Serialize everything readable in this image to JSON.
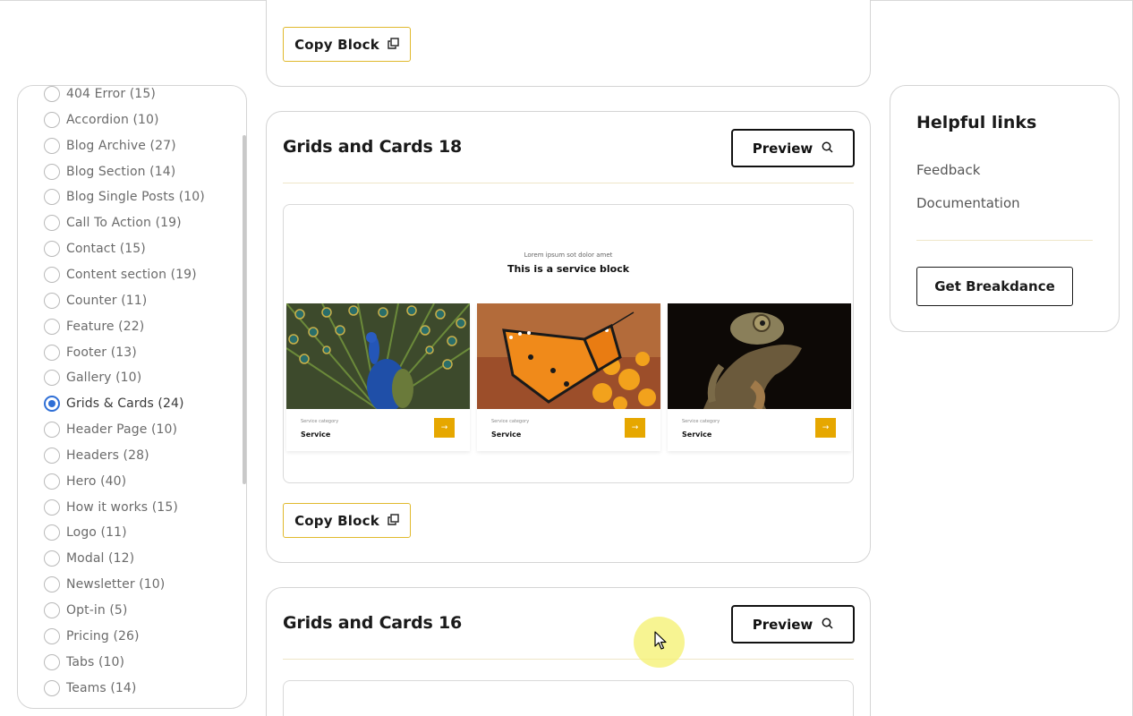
{
  "categories": [
    {
      "label": "404 Error (15)",
      "checked": false
    },
    {
      "label": "Accordion (10)",
      "checked": false
    },
    {
      "label": "Blog Archive (27)",
      "checked": false
    },
    {
      "label": "Blog Section (14)",
      "checked": false
    },
    {
      "label": "Blog Single Posts (10)",
      "checked": false
    },
    {
      "label": "Call To Action (19)",
      "checked": false
    },
    {
      "label": "Contact (15)",
      "checked": false
    },
    {
      "label": "Content section (19)",
      "checked": false
    },
    {
      "label": "Counter (11)",
      "checked": false
    },
    {
      "label": "Feature (22)",
      "checked": false
    },
    {
      "label": "Footer (13)",
      "checked": false
    },
    {
      "label": "Gallery (10)",
      "checked": false
    },
    {
      "label": "Grids & Cards (24)",
      "checked": true
    },
    {
      "label": "Header Page (10)",
      "checked": false
    },
    {
      "label": "Headers (28)",
      "checked": false
    },
    {
      "label": "Hero (40)",
      "checked": false
    },
    {
      "label": "How it works (15)",
      "checked": false
    },
    {
      "label": "Logo (11)",
      "checked": false
    },
    {
      "label": "Modal (12)",
      "checked": false
    },
    {
      "label": "Newsletter (10)",
      "checked": false
    },
    {
      "label": "Opt-in (5)",
      "checked": false
    },
    {
      "label": "Pricing (26)",
      "checked": false
    },
    {
      "label": "Tabs (10)",
      "checked": false
    },
    {
      "label": "Teams (14)",
      "checked": false
    }
  ],
  "blocks": {
    "top": {
      "copy_label": "Copy Block"
    },
    "middle": {
      "title": "Grids and Cards 18",
      "preview_label": "Preview",
      "copy_label": "Copy Block",
      "thumbnail": {
        "eyebrow": "Lorem ipsum sot dolor amet",
        "heading": "This is a service block",
        "services": [
          {
            "category": "Service category",
            "name": "Service",
            "image": "peacock"
          },
          {
            "category": "Service category",
            "name": "Service",
            "image": "butterfly"
          },
          {
            "category": "Service category",
            "name": "Service",
            "image": "chameleon"
          }
        ]
      }
    },
    "bottom": {
      "title": "Grids and Cards 16",
      "preview_label": "Preview"
    }
  },
  "helpful_links": {
    "title": "Helpful links",
    "links": [
      "Feedback",
      "Documentation"
    ],
    "cta_label": "Get Breakdance"
  },
  "colors": {
    "accent_yellow": "#e6a700",
    "radio_checked": "#2f6fd6",
    "border": "#d4d4d4"
  }
}
